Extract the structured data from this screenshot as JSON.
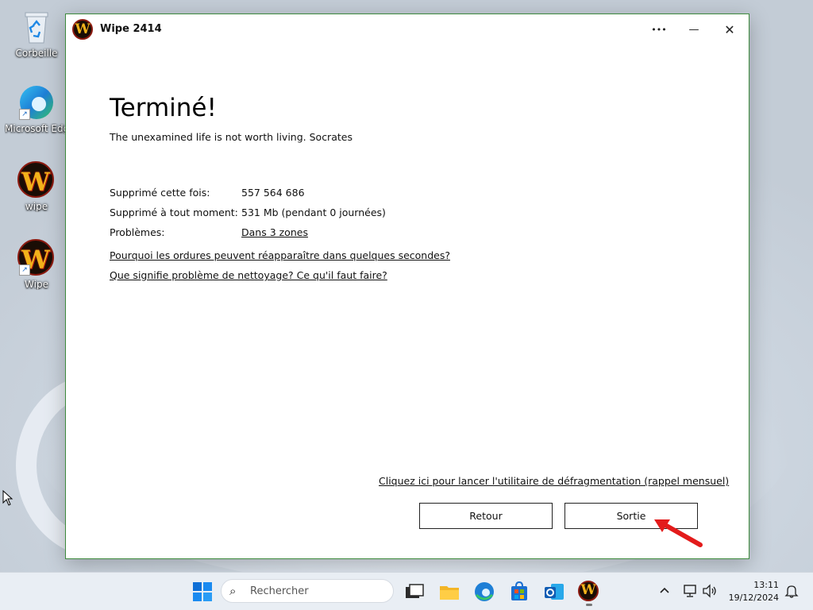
{
  "desktop": {
    "icons": [
      {
        "label": "Corbeille",
        "icon": "recycle-bin-icon"
      },
      {
        "label": "Microsoft Edge",
        "icon": "edge-icon"
      },
      {
        "label": "wipe",
        "icon": "wipe-icon"
      },
      {
        "label": "Wipe",
        "icon": "wipe-icon"
      }
    ]
  },
  "window": {
    "title": "Wipe 2414",
    "controls": {
      "more": "•••",
      "minimize": "—",
      "close": "✕"
    }
  },
  "content": {
    "heading": "Terminé!",
    "quote": "The unexamined life is not worth living. Socrates",
    "stats": [
      {
        "label": "Supprimé cette fois:",
        "value": "557 564 686"
      },
      {
        "label": "Supprimé à tout moment:",
        "value": "531 Mb (pendant 0 journées)"
      },
      {
        "label": "Problèmes:",
        "value": "Dans 3 zones"
      }
    ],
    "links": {
      "why_reappear": "Pourquoi les ordures peuvent réapparaître dans quelques secondes?",
      "cleaning_problem": "Que signifie problème de nettoyage? Ce qu'il faut faire?",
      "defrag": "Cliquez ici pour lancer l'utilitaire de défragmentation (rappel mensuel)"
    },
    "buttons": {
      "back": "Retour",
      "exit": "Sortie"
    }
  },
  "taskbar": {
    "search_placeholder": "Rechercher",
    "time": "13:11",
    "date": "19/12/2024"
  },
  "colors": {
    "annotation_arrow": "#e31b1b",
    "window_border": "#3d8a3d"
  }
}
